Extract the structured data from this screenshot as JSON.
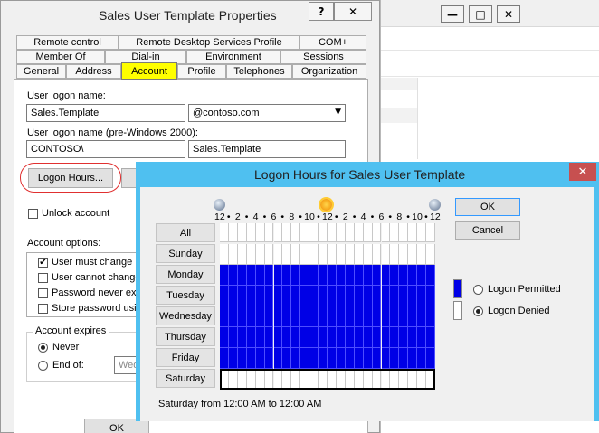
{
  "background_window": {
    "minimize": "—",
    "restore": "□",
    "close": "✕"
  },
  "props": {
    "title": "Sales User Template Properties",
    "help_btn": "?",
    "close_btn": "✕",
    "tabs_row1": [
      "Remote control",
      "Remote Desktop Services Profile",
      "COM+"
    ],
    "tabs_row2": [
      "Member Of",
      "Dial-in",
      "Environment",
      "Sessions"
    ],
    "tabs_row3": [
      "General",
      "Address",
      "Account",
      "Profile",
      "Telephones",
      "Organization"
    ],
    "active_tab": "Account",
    "logon_name_label": "User logon name:",
    "logon_name_value": "Sales.Template",
    "domain_value": "@contoso.com",
    "pre2000_label": "User logon name (pre-Windows 2000):",
    "pre2000_domain": "CONTOSO\\",
    "pre2000_name": "Sales.Template",
    "logon_hours_btn": "Logon Hours...",
    "unlock_label": "Unlock account",
    "account_options_label": "Account options:",
    "options": [
      {
        "label": "User must change pa",
        "checked": true
      },
      {
        "label": "User cannot change",
        "checked": false
      },
      {
        "label": "Password never exp",
        "checked": false
      },
      {
        "label": "Store password using",
        "checked": false
      }
    ],
    "expires_label": "Account expires",
    "never_label": "Never",
    "endof_label": "End of:",
    "endof_value": "Wed",
    "ok_btn": "OK"
  },
  "logon_hours": {
    "title": "Logon Hours for Sales User Template",
    "close": "✕",
    "all_label": "All",
    "hour_labels": [
      "12",
      "2",
      "4",
      "6",
      "8",
      "10",
      "12",
      "2",
      "4",
      "6",
      "8",
      "10",
      "12"
    ],
    "days": [
      {
        "name": "Sunday",
        "permitted": false
      },
      {
        "name": "Monday",
        "permitted": true
      },
      {
        "name": "Tuesday",
        "permitted": true
      },
      {
        "name": "Wednesday",
        "permitted": true
      },
      {
        "name": "Thursday",
        "permitted": true
      },
      {
        "name": "Friday",
        "permitted": true
      },
      {
        "name": "Saturday",
        "permitted": false,
        "selected": true
      }
    ],
    "ok_btn": "OK",
    "cancel_btn": "Cancel",
    "legend_permitted": "Logon Permitted",
    "legend_denied": "Logon Denied",
    "legend_selected": "Logon Denied",
    "status": "Saturday from 12:00 AM to 12:00 AM",
    "colors": {
      "permitted": "#0000e6",
      "denied": "#ffffff",
      "grid": "#4d4dff",
      "accent": "#4fc0f0"
    }
  }
}
